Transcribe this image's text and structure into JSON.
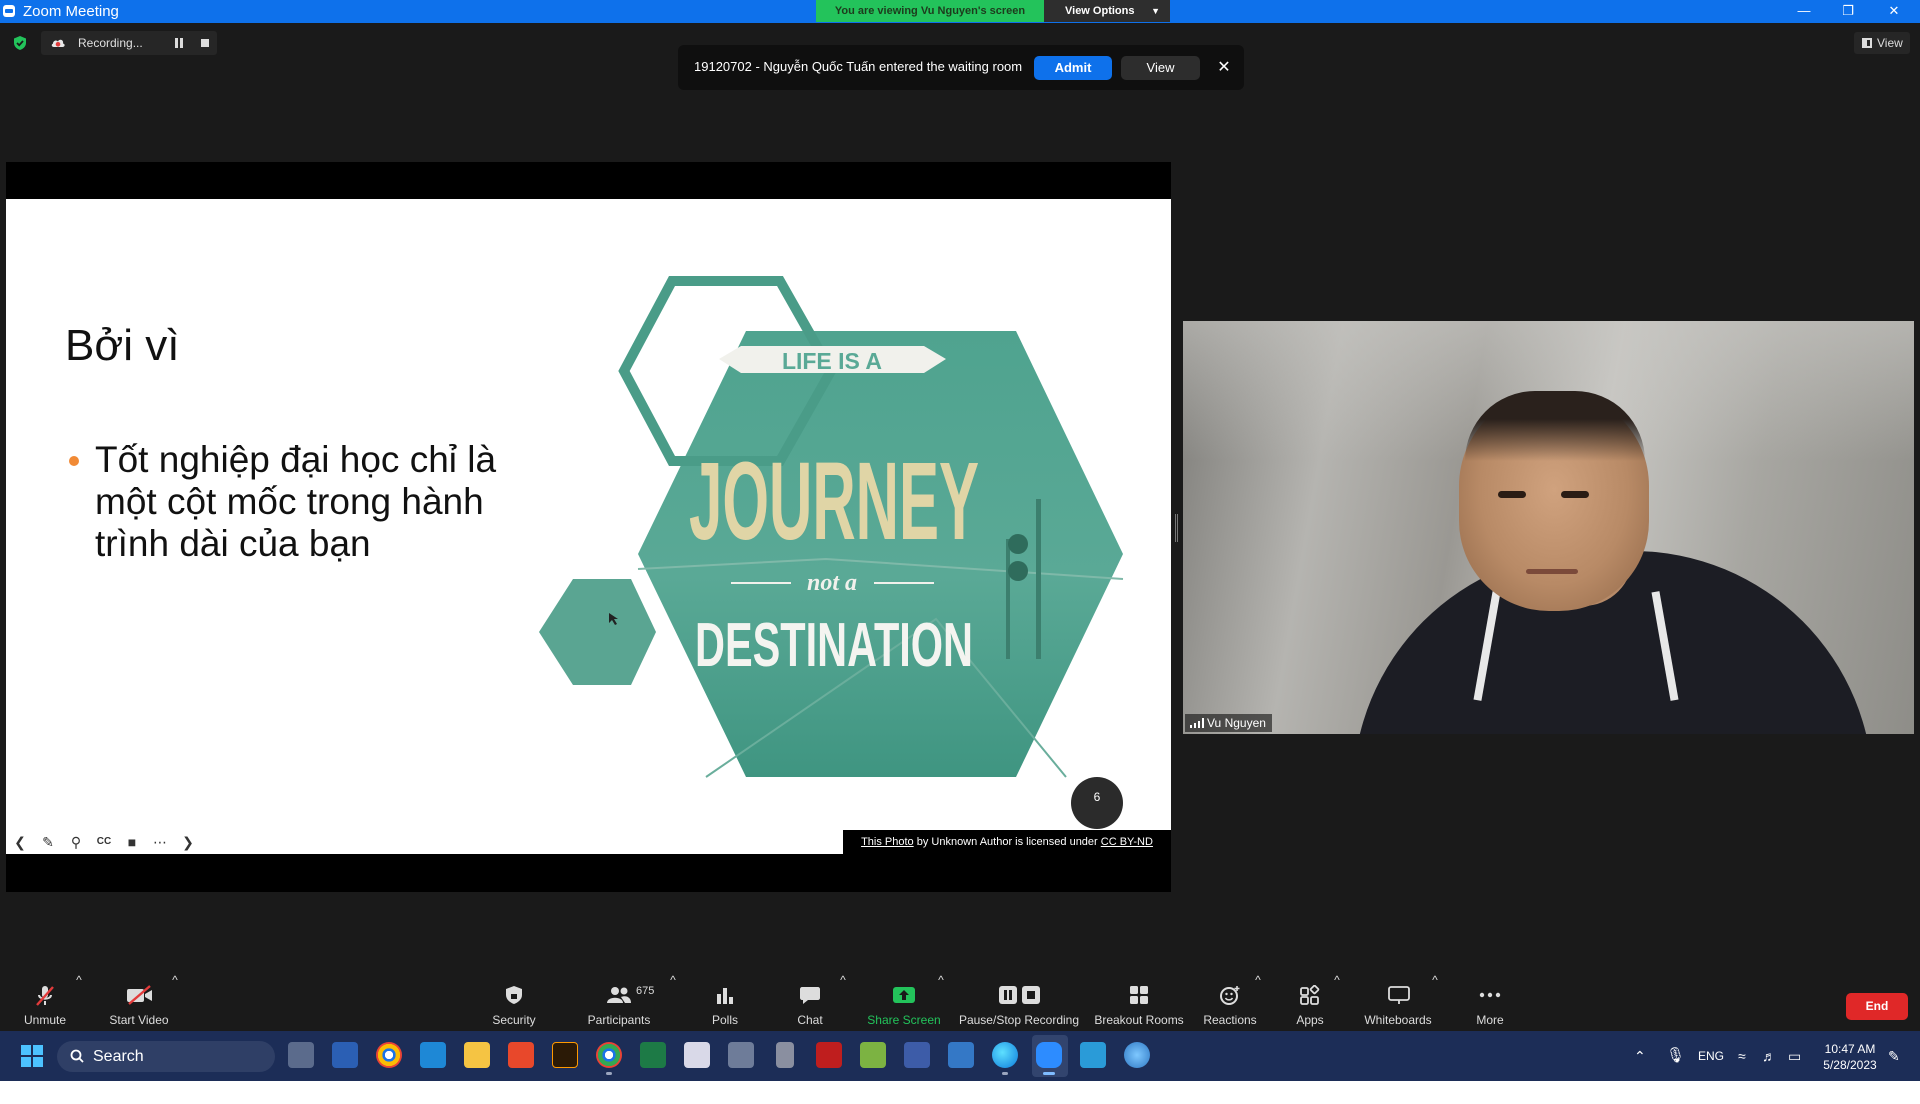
{
  "window": {
    "title": "Zoom Meeting"
  },
  "share_banner": {
    "viewing": "You are viewing Vu Nguyen's screen",
    "view_options": "View Options"
  },
  "recording": {
    "label": "Recording..."
  },
  "top_view_label": "View",
  "waiting_room": {
    "message": "19120702 - Nguyễn Quốc Tuấn entered the waiting room",
    "admit": "Admit",
    "view": "View"
  },
  "slide": {
    "title": "Bởi vì",
    "bullet": "Tốt nghiệp đại học chỉ là một cột mốc trong hành trình dài của bạn",
    "graphic_text": {
      "line1": "LIFE IS A",
      "line2": "JOURNEY",
      "line3": "not a",
      "line4": "DESTINATION"
    },
    "page_number": "6",
    "credit": {
      "link": "This Photo",
      "middle": " by Unknown Author is licensed under ",
      "license": "CC BY-ND"
    }
  },
  "participant": {
    "name": "Vu Nguyen"
  },
  "controls": {
    "unmute": "Unmute",
    "start_video": "Start Video",
    "security": "Security",
    "participants": "Participants",
    "participants_count": "675",
    "polls": "Polls",
    "chat": "Chat",
    "share_screen": "Share Screen",
    "pause_stop_recording": "Pause/Stop Recording",
    "breakout_rooms": "Breakout Rooms",
    "reactions": "Reactions",
    "apps": "Apps",
    "whiteboards": "Whiteboards",
    "more": "More",
    "end": "End"
  },
  "taskbar": {
    "search": "Search",
    "language": "ENG",
    "time": "10:47 AM",
    "date": "5/28/2023"
  },
  "colors": {
    "zoom_blue": "#0e71eb",
    "share_green": "#23c35b",
    "end_red": "#e02828",
    "slide_teal": "#4a9c88",
    "bullet_orange": "#f18a35"
  }
}
